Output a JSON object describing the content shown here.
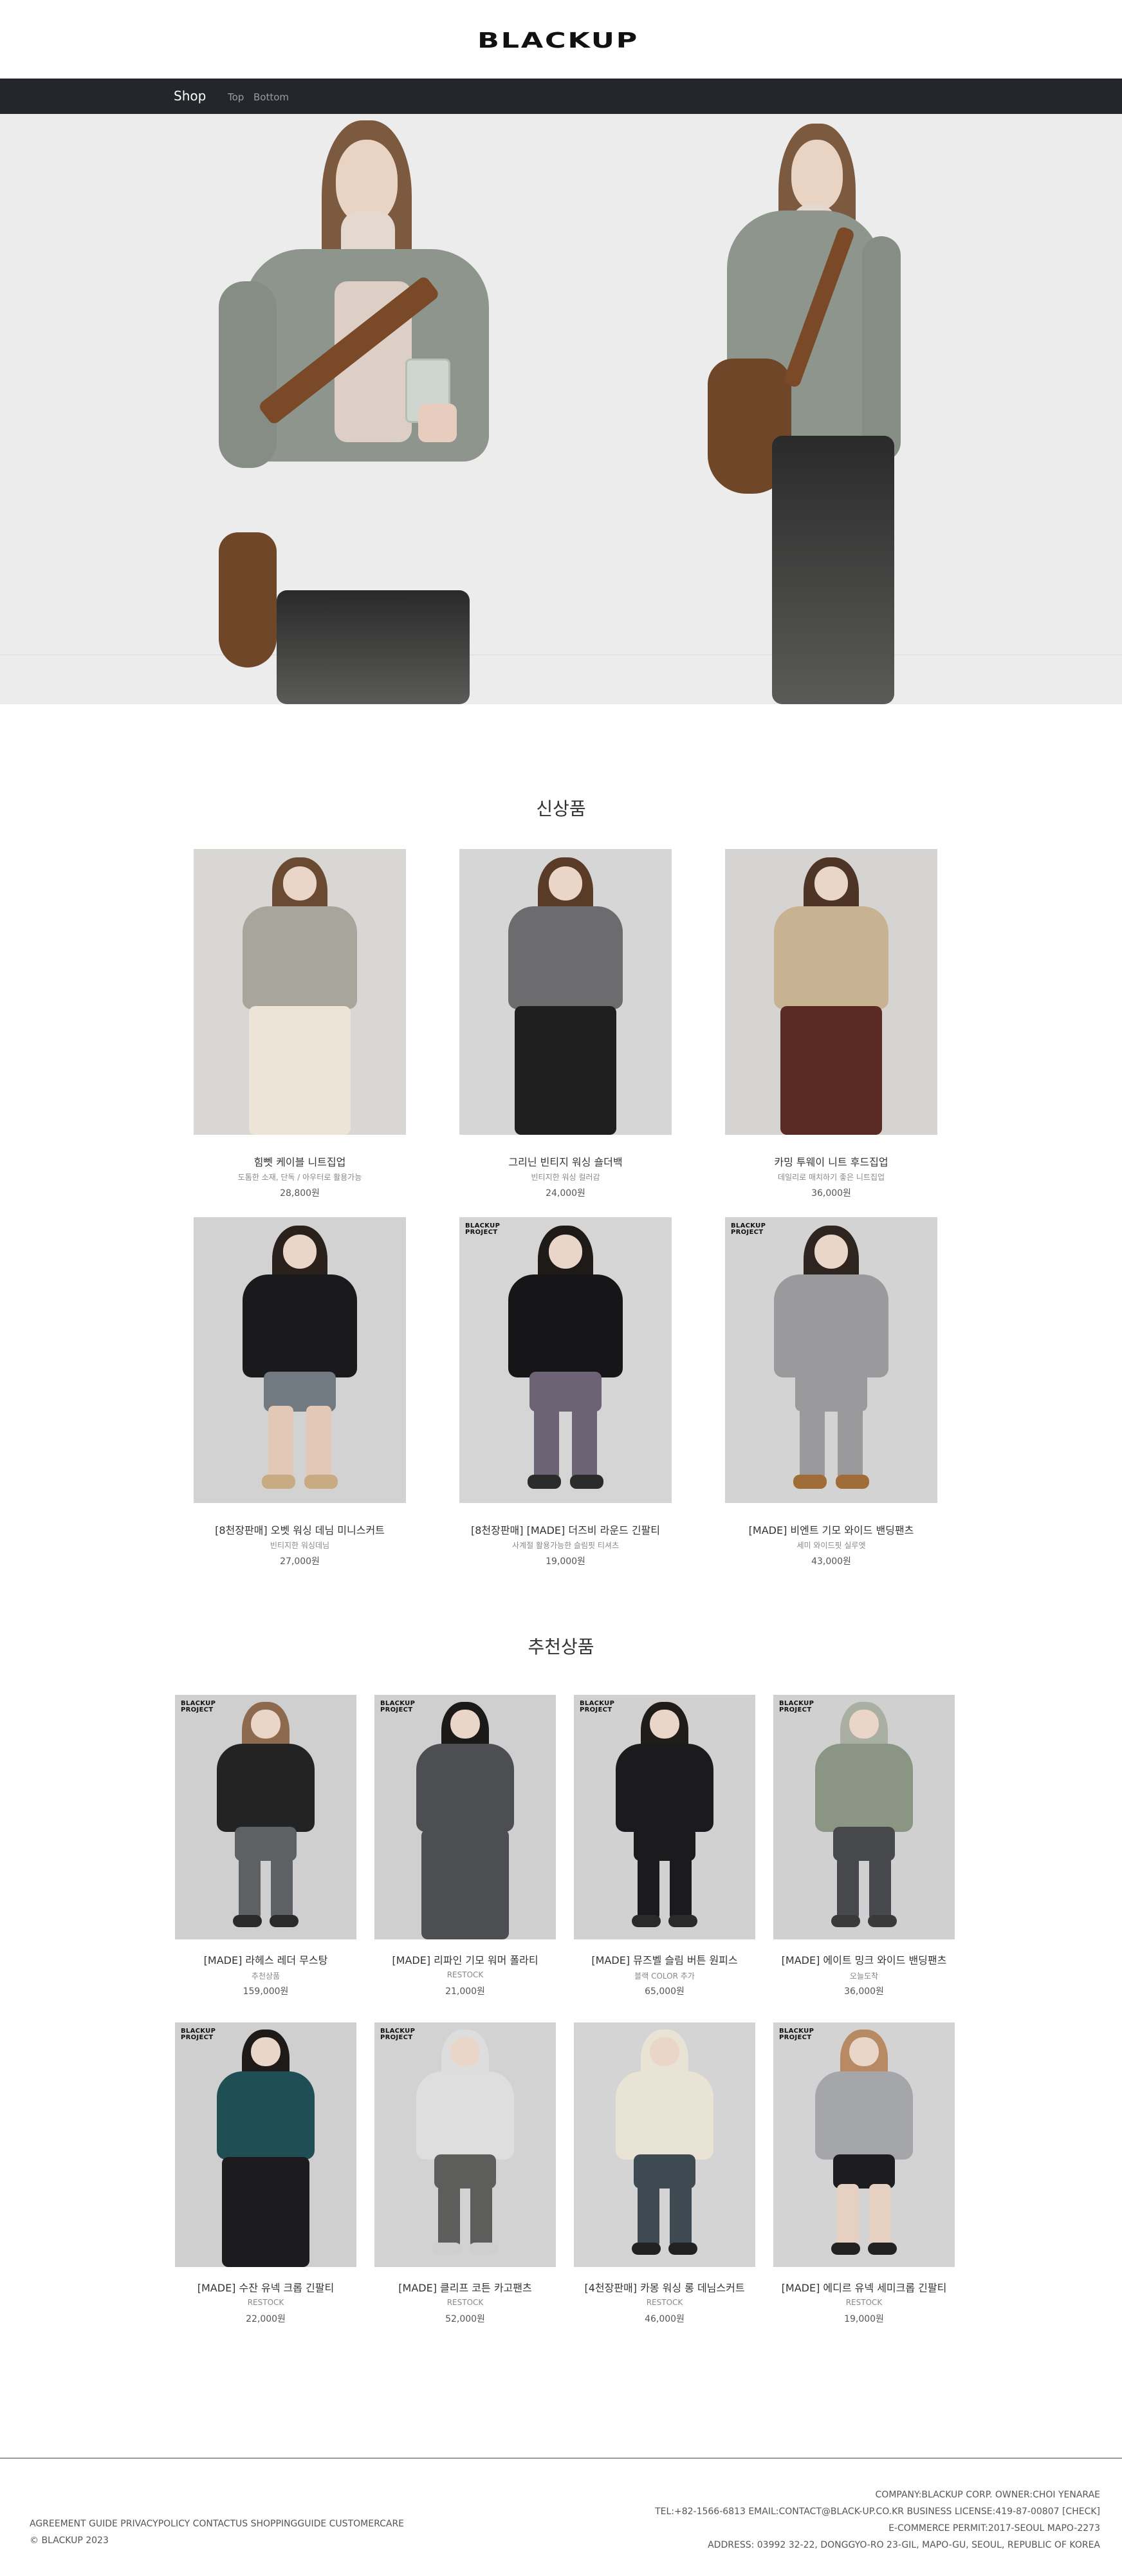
{
  "brand": {
    "logo_text": "BLACKUP"
  },
  "nav": {
    "shop_label": "Shop",
    "top_label": "Top",
    "bottom_label": "Bottom"
  },
  "new_section": {
    "title": "신상품",
    "products": [
      {
        "name": "힘뻿 케이블 니트집업",
        "desc": "도톰한 소재, 단독 / 아우터로 활용가능",
        "price": "28,800원"
      },
      {
        "name": "그리닌 빈티지 워싱 숄더백",
        "desc": "빈티지한 워싱 컬러감",
        "price": "24,000원"
      },
      {
        "name": "카밍 투웨이 니트 후드집업",
        "desc": "데일리로 매치하기 좋은 니트집업",
        "price": "36,000원"
      },
      {
        "name": "[8천장판매] 오벳 워싱 데님 미니스커트",
        "desc": "빈티지한 워싱데님",
        "price": "27,000원"
      },
      {
        "name": "[8천장판매] [MADE] 더즈비 라운드 긴팔티",
        "desc": "사계절 활용가능한 슬림핏 티셔츠",
        "price": "19,000원"
      },
      {
        "name": "[MADE] 비엔트 기모 와이드 밴딩팬츠",
        "desc": "세미 와이드핏 실루엣",
        "price": "43,000원"
      }
    ]
  },
  "recommended_section": {
    "title": "추천상품",
    "products": [
      {
        "name": "[MADE] 라헤스 레더 무스탕",
        "desc": "추천상품",
        "price": "159,000원"
      },
      {
        "name": "[MADE] 리파인 기모 워머 폴라티",
        "desc": "RESTOCK",
        "price": "21,000원"
      },
      {
        "name": "[MADE] 뮤즈벨 슬림 버튼 원피스",
        "desc": "블랙 COLOR 추가",
        "price": "65,000원"
      },
      {
        "name": "[MADE] 에이트 밍크 와이드 밴딩팬츠",
        "desc": "오늘도착",
        "price": "36,000원"
      },
      {
        "name": "[MADE] 수잔 유넥 크롭 긴팔티",
        "desc": "RESTOCK",
        "price": "22,000원"
      },
      {
        "name": "[MADE] 클리프 코튼 카고팬츠",
        "desc": "RESTOCK",
        "price": "52,000원"
      },
      {
        "name": "[4천장판매] 카몽 워싱 롱 데님스커트",
        "desc": "RESTOCK",
        "price": "46,000원"
      },
      {
        "name": "[MADE] 에디르 유넥 세미크롭 긴팔티",
        "desc": "RESTOCK",
        "price": "19,000원"
      }
    ]
  },
  "badge": {
    "line1": "BLACKUP",
    "line2": "PROJECT"
  },
  "footer": {
    "links": "AGREEMENT GUIDE PRIVACYPOLICY CONTACTUS SHOPPINGGUIDE CUSTOMERCARE",
    "copyright": "© BLACKUP 2023",
    "company": "COMPANY:BLACKUP CORP. OWNER:CHOI YENARAE",
    "contact": "TEL:+82-1566-6813 EMAIL:CONTACT@BLACK-UP.CO.KR BUSINESS LICENSE:419-87-00807 [CHECK]",
    "permit": "E-COMMERCE PERMIT:2017-SEOUL MAPO-2273",
    "address": "ADDRESS: 03992 32-22, DONGGYO-RO 23-GIL, MAPO-GU, SEOUL, REPUBLIC OF KOREA"
  },
  "colors": {
    "nav_bg": "#24262b",
    "hero_bg": "#ececec",
    "card_bg": "#d7d7d7"
  }
}
